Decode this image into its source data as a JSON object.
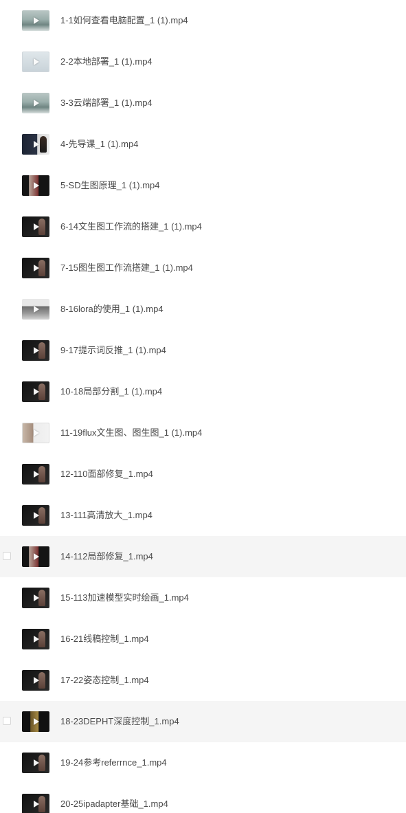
{
  "files": [
    {
      "name": "1-1如何查看电脑配置_1 (1).mp4",
      "thumb": "landscape"
    },
    {
      "name": "2-2本地部署_1 (1).mp4",
      "thumb": "light"
    },
    {
      "name": "3-3云端部署_1 (1).mp4",
      "thumb": "landscape"
    },
    {
      "name": "4-先导课_1 (1).mp4",
      "thumb": "portrait"
    },
    {
      "name": "5-SD生图原理_1 (1).mp4",
      "thumb": "portrait-red"
    },
    {
      "name": "6-14文生图工作流的搭建_1 (1).mp4",
      "thumb": "dark"
    },
    {
      "name": "7-15图生图工作流搭建_1 (1).mp4",
      "thumb": "dark"
    },
    {
      "name": "8-16lora的使用_1 (1).mp4",
      "thumb": "screen"
    },
    {
      "name": "9-17提示词反推_1 (1).mp4",
      "thumb": "dark"
    },
    {
      "name": "10-18局部分割_1 (1).mp4",
      "thumb": "dark"
    },
    {
      "name": "11-19flux文生图、图生图_1 (1).mp4",
      "thumb": "light-portrait"
    },
    {
      "name": "12-110面部修复_1.mp4",
      "thumb": "dark"
    },
    {
      "name": "13-111高清放大_1.mp4",
      "thumb": "dark"
    },
    {
      "name": "14-112局部修复_1.mp4",
      "thumb": "portrait-red",
      "hovered": true
    },
    {
      "name": "15-113加速模型实时绘画_1.mp4",
      "thumb": "dark"
    },
    {
      "name": "16-21线稿控制_1.mp4",
      "thumb": "dark"
    },
    {
      "name": "17-22姿态控制_1.mp4",
      "thumb": "dark"
    },
    {
      "name": "18-23DEPHT深度控制_1.mp4",
      "thumb": "dark-gold",
      "hovered": true
    },
    {
      "name": "19-24参考referrnce_1.mp4",
      "thumb": "dark"
    },
    {
      "name": "20-25ipadapter基础_1.mp4",
      "thumb": "dark"
    }
  ],
  "colors": {
    "row_hover": "#f5f5f5",
    "text": "#4a4a4a"
  }
}
